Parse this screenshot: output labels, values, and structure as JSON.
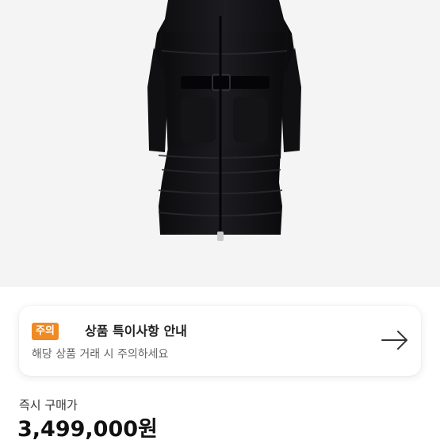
{
  "product": {
    "image_alt": "black-long-down-coat"
  },
  "notice": {
    "badge": "주의",
    "title": "상품 특이사항 안내",
    "subtitle": "해당 상품 거래 시 주의하세요",
    "action_icon": "arrow-right-icon",
    "badge_color": "#f08a24"
  },
  "price": {
    "label": "즉시 구매가",
    "value": "3,499,000원"
  }
}
